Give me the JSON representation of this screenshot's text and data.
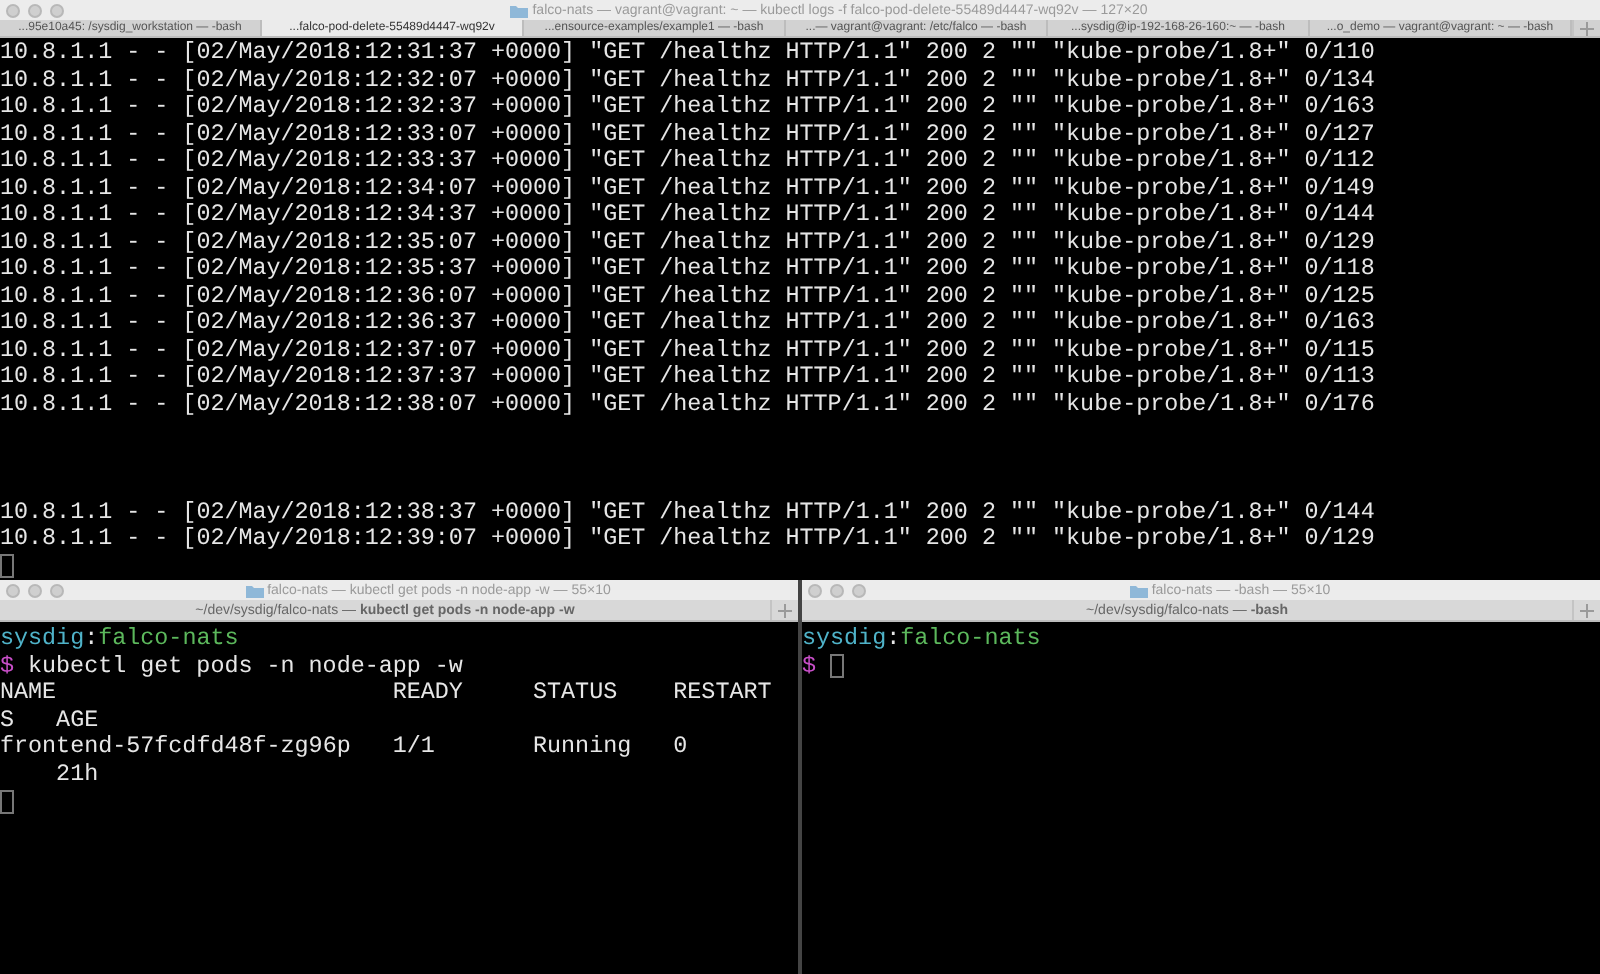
{
  "top_window": {
    "title": "falco-nats — vagrant@vagrant: ~ — kubectl logs -f falco-pod-delete-55489d4447-wq92v — 127×20",
    "tabs": [
      {
        "label": "...95e10a45: /sysdig_workstation — -bash",
        "selected": false
      },
      {
        "label": "...falco-pod-delete-55489d4447-wq92v",
        "selected": true
      },
      {
        "label": "...ensource-examples/example1 — -bash",
        "selected": false
      },
      {
        "label": "...— vagrant@vagrant: /etc/falco — -bash",
        "selected": false
      },
      {
        "label": "...sysdig@ip-192-168-26-160:~ — -bash",
        "selected": false
      },
      {
        "label": "...o_demo — vagrant@vagrant: ~ — -bash",
        "selected": false
      }
    ],
    "lines": [
      {
        "kind": "output",
        "text": "10.8.1.1 - - [02/May/2018:12:31:37 +0000] \"GET /healthz HTTP/1.1\" 200 2 \"\" \"kube-probe/1.8+\" 0/110"
      },
      {
        "kind": "output",
        "text": "10.8.1.1 - - [02/May/2018:12:32:07 +0000] \"GET /healthz HTTP/1.1\" 200 2 \"\" \"kube-probe/1.8+\" 0/134"
      },
      {
        "kind": "output",
        "text": "10.8.1.1 - - [02/May/2018:12:32:37 +0000] \"GET /healthz HTTP/1.1\" 200 2 \"\" \"kube-probe/1.8+\" 0/163"
      },
      {
        "kind": "output",
        "text": "10.8.1.1 - - [02/May/2018:12:33:07 +0000] \"GET /healthz HTTP/1.1\" 200 2 \"\" \"kube-probe/1.8+\" 0/127"
      },
      {
        "kind": "output",
        "text": "10.8.1.1 - - [02/May/2018:12:33:37 +0000] \"GET /healthz HTTP/1.1\" 200 2 \"\" \"kube-probe/1.8+\" 0/112"
      },
      {
        "kind": "output",
        "text": "10.8.1.1 - - [02/May/2018:12:34:07 +0000] \"GET /healthz HTTP/1.1\" 200 2 \"\" \"kube-probe/1.8+\" 0/149"
      },
      {
        "kind": "output",
        "text": "10.8.1.1 - - [02/May/2018:12:34:37 +0000] \"GET /healthz HTTP/1.1\" 200 2 \"\" \"kube-probe/1.8+\" 0/144"
      },
      {
        "kind": "output",
        "text": "10.8.1.1 - - [02/May/2018:12:35:07 +0000] \"GET /healthz HTTP/1.1\" 200 2 \"\" \"kube-probe/1.8+\" 0/129"
      },
      {
        "kind": "output",
        "text": "10.8.1.1 - - [02/May/2018:12:35:37 +0000] \"GET /healthz HTTP/1.1\" 200 2 \"\" \"kube-probe/1.8+\" 0/118"
      },
      {
        "kind": "output",
        "text": "10.8.1.1 - - [02/May/2018:12:36:07 +0000] \"GET /healthz HTTP/1.1\" 200 2 \"\" \"kube-probe/1.8+\" 0/125"
      },
      {
        "kind": "output",
        "text": "10.8.1.1 - - [02/May/2018:12:36:37 +0000] \"GET /healthz HTTP/1.1\" 200 2 \"\" \"kube-probe/1.8+\" 0/163"
      },
      {
        "kind": "output",
        "text": "10.8.1.1 - - [02/May/2018:12:37:07 +0000] \"GET /healthz HTTP/1.1\" 200 2 \"\" \"kube-probe/1.8+\" 0/115"
      },
      {
        "kind": "output",
        "text": "10.8.1.1 - - [02/May/2018:12:37:37 +0000] \"GET /healthz HTTP/1.1\" 200 2 \"\" \"kube-probe/1.8+\" 0/113"
      },
      {
        "kind": "output",
        "text": "10.8.1.1 - - [02/May/2018:12:38:07 +0000] \"GET /healthz HTTP/1.1\" 200 2 \"\" \"kube-probe/1.8+\" 0/176"
      },
      {
        "kind": "blank"
      },
      {
        "kind": "blank"
      },
      {
        "kind": "blank"
      },
      {
        "kind": "output",
        "text": "10.8.1.1 - - [02/May/2018:12:38:37 +0000] \"GET /healthz HTTP/1.1\" 200 2 \"\" \"kube-probe/1.8+\" 0/144"
      },
      {
        "kind": "output",
        "text": "10.8.1.1 - - [02/May/2018:12:39:07 +0000] \"GET /healthz HTTP/1.1\" 200 2 \"\" \"kube-probe/1.8+\" 0/129"
      },
      {
        "kind": "cursor"
      }
    ]
  },
  "bottom_windows": [
    {
      "title": "falco-nats — kubectl get pods -n node-app -w — 55×10",
      "tab": "~/dev/sysdig/falco-nats — **kubectl get pods -n node-app -w**",
      "lines": [
        {
          "kind": "prompt",
          "user": "sysdig",
          "separator": ":",
          "host": "falco-nats"
        },
        {
          "kind": "command",
          "symbol": "$",
          "command": "kubectl get pods -n node-app -w",
          "cursor": false
        },
        {
          "kind": "output",
          "text": "NAME                        READY     STATUS    RESTART"
        },
        {
          "kind": "output",
          "text": "S   AGE"
        },
        {
          "kind": "output",
          "text": "frontend-57fcdfd48f-zg96p   1/1       Running   0"
        },
        {
          "kind": "output",
          "text": "    21h"
        },
        {
          "kind": "cursor"
        }
      ]
    },
    {
      "title": "falco-nats — -bash — 55×10",
      "tab": "~/dev/sysdig/falco-nats — **-bash**",
      "lines": [
        {
          "kind": "prompt",
          "user": "sysdig",
          "separator": ":",
          "host": "falco-nats"
        },
        {
          "kind": "command",
          "symbol": "$",
          "cursor": true
        }
      ]
    }
  ]
}
